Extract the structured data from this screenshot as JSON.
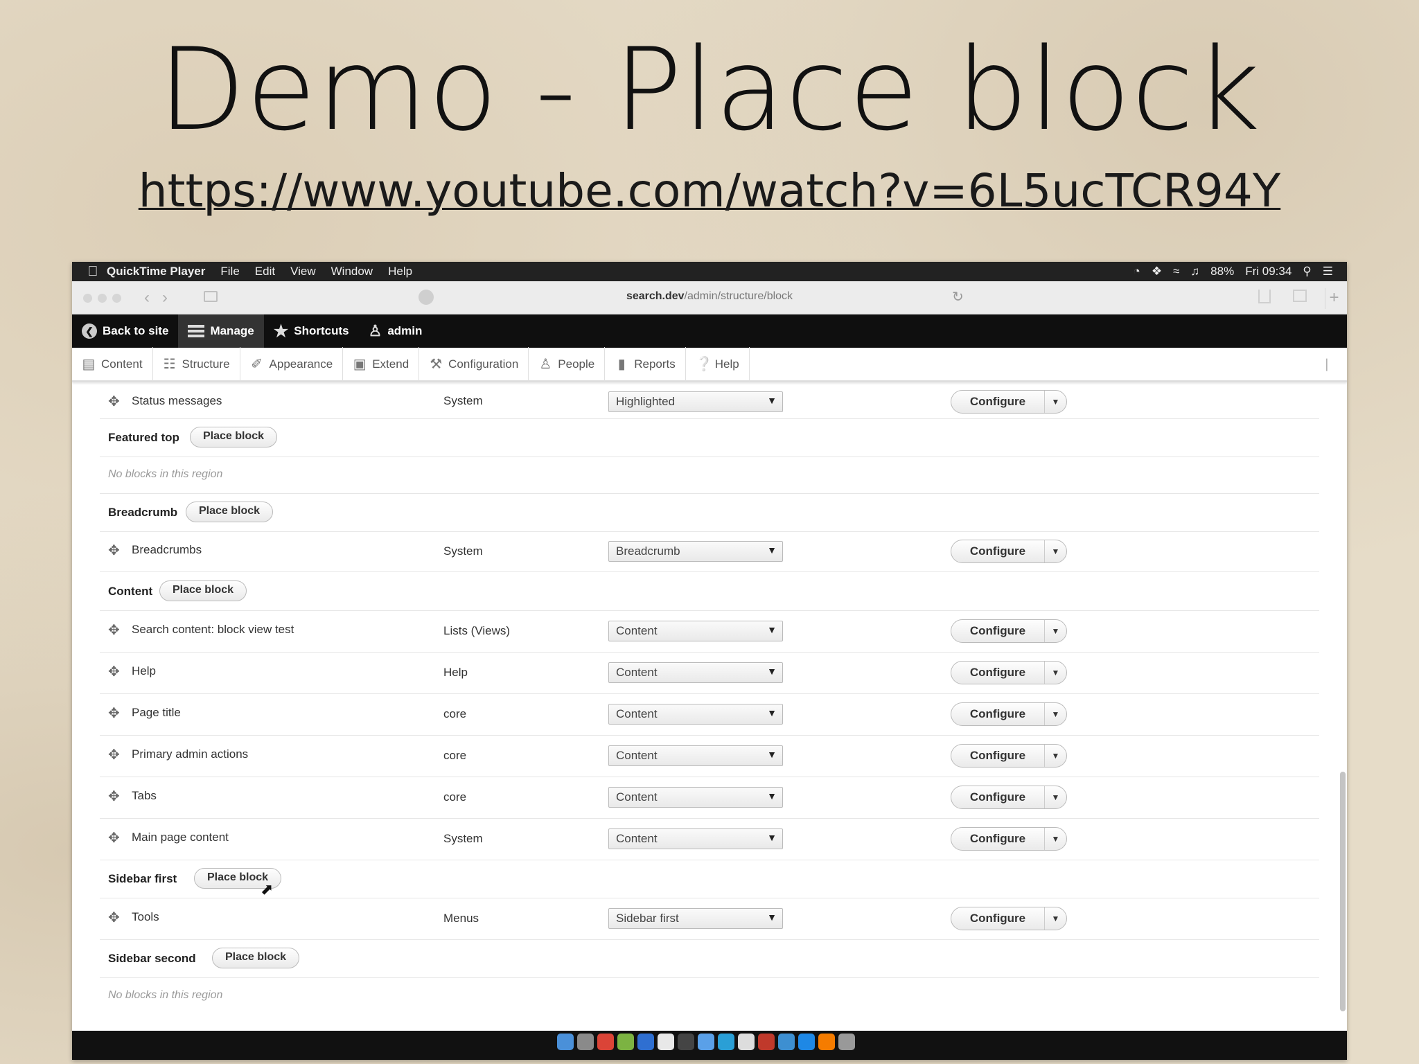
{
  "slide": {
    "title": "Demo - Place block",
    "link": "https://www.youtube.com/watch?v=6L5ucTCR94Y"
  },
  "macmenu": {
    "app": "QuickTime Player",
    "items": [
      "File",
      "Edit",
      "View",
      "Window",
      "Help"
    ],
    "battery": "88%",
    "clock": "Fri 09:34"
  },
  "browser": {
    "url_host": "search.dev",
    "url_path": "/admin/structure/block"
  },
  "toolbar": {
    "back": "Back to site",
    "manage": "Manage",
    "shortcuts": "Shortcuts",
    "user": "admin"
  },
  "tray": {
    "items": [
      "Content",
      "Structure",
      "Appearance",
      "Extend",
      "Configuration",
      "People",
      "Reports",
      "Help"
    ]
  },
  "labels": {
    "configure": "Configure",
    "place_block": "Place block",
    "no_blocks": "No blocks in this region"
  },
  "blocks": {
    "status": {
      "name": "Status messages",
      "category": "System",
      "region": "Highlighted"
    },
    "breadcrumbs": {
      "name": "Breadcrumbs",
      "category": "System",
      "region": "Breadcrumb"
    },
    "search": {
      "name": "Search content: block view test",
      "category": "Lists (Views)",
      "region": "Content"
    },
    "help": {
      "name": "Help",
      "category": "Help",
      "region": "Content"
    },
    "pagetitle": {
      "name": "Page title",
      "category": "core",
      "region": "Content"
    },
    "primary": {
      "name": "Primary admin actions",
      "category": "core",
      "region": "Content"
    },
    "tabs": {
      "name": "Tabs",
      "category": "core",
      "region": "Content"
    },
    "main": {
      "name": "Main page content",
      "category": "System",
      "region": "Content"
    },
    "tools": {
      "name": "Tools",
      "category": "Menus",
      "region": "Sidebar first"
    }
  },
  "regions": {
    "featured": "Featured top",
    "breadcrumb": "Breadcrumb",
    "content": "Content",
    "sidebar_first": "Sidebar first",
    "sidebar_second": "Sidebar second"
  }
}
